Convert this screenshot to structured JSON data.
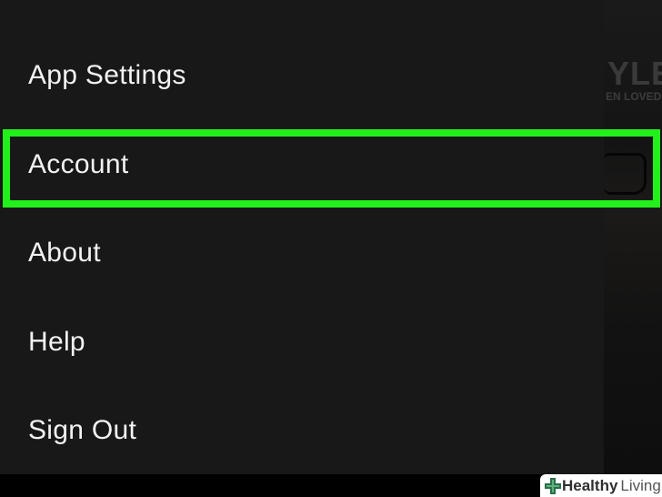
{
  "menu": {
    "items": [
      {
        "label": "App Settings"
      },
      {
        "label": "Account"
      },
      {
        "label": "About"
      },
      {
        "label": "Help"
      },
      {
        "label": "Sign Out"
      }
    ],
    "selected": "Account"
  },
  "background_poster": {
    "title": "YLE",
    "subtitle": "EN LOVED"
  },
  "watermark": {
    "brand_bold": "Healthy",
    "brand_light": "Living",
    "icon": "medical-cross-icon"
  },
  "colors": {
    "drawer": "#181818",
    "text": "#f2f2f2",
    "highlight": "#22f01a"
  }
}
